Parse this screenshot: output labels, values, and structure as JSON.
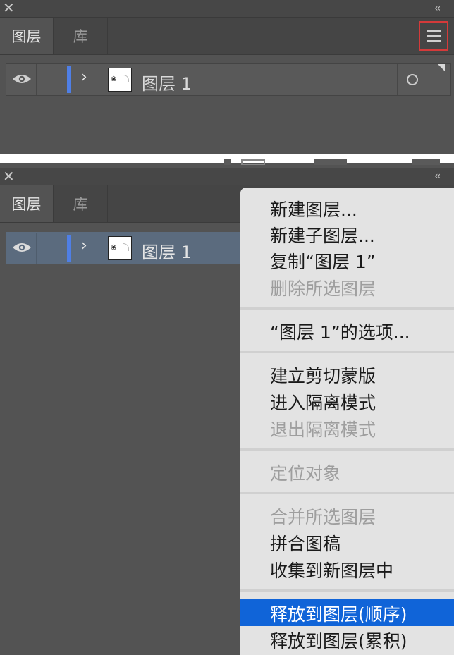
{
  "panel_top": {
    "tabs": [
      "图层",
      "库"
    ],
    "collapse_glyph": "‹‹",
    "layer": {
      "name": "图层 1"
    }
  },
  "panel_bottom": {
    "tabs": [
      "图层",
      "库"
    ],
    "collapse_glyph": "‹‹",
    "layer": {
      "name": "图层 1"
    }
  },
  "context_menu": {
    "groups": [
      [
        {
          "label": "新建图层...",
          "enabled": true
        },
        {
          "label": "新建子图层...",
          "enabled": true
        },
        {
          "label": "复制“图层 1”",
          "enabled": true
        },
        {
          "label": "删除所选图层",
          "enabled": false
        }
      ],
      [
        {
          "label": "“图层 1”的选项...",
          "enabled": true
        }
      ],
      [
        {
          "label": "建立剪切蒙版",
          "enabled": true
        },
        {
          "label": "进入隔离模式",
          "enabled": true
        },
        {
          "label": "退出隔离模式",
          "enabled": false
        }
      ],
      [
        {
          "label": "定位对象",
          "enabled": false
        }
      ],
      [
        {
          "label": "合并所选图层",
          "enabled": false
        },
        {
          "label": "拼合图稿",
          "enabled": true
        },
        {
          "label": "收集到新图层中",
          "enabled": true
        }
      ],
      [
        {
          "label": "释放到图层(顺序)",
          "enabled": true,
          "highlighted": true
        },
        {
          "label": "释放到图层(累积)",
          "enabled": true
        }
      ]
    ]
  },
  "colors": {
    "panel_bg": "#535353",
    "layer_color": "#4f7fe6",
    "selected_row": "#5b6b7e",
    "menu_highlight": "#1064d8",
    "menu_bg": "#e3e3e3",
    "flag_border": "#d43a3a"
  }
}
